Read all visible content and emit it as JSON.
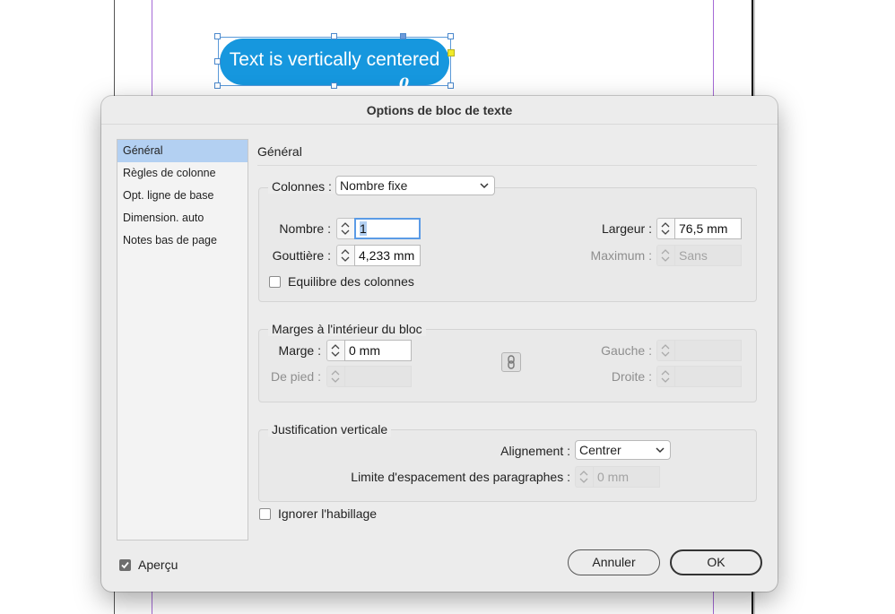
{
  "document": {
    "frame_text": "Text is vertically centered",
    "overflow_glyph": "0"
  },
  "dialog": {
    "title": "Options de bloc de texte",
    "sidebar": {
      "items": [
        {
          "label": "Général",
          "selected": true
        },
        {
          "label": "Règles de colonne",
          "selected": false
        },
        {
          "label": "Opt. ligne de base",
          "selected": false
        },
        {
          "label": "Dimension. auto",
          "selected": false
        },
        {
          "label": "Notes bas de page",
          "selected": false
        }
      ]
    },
    "section_title": "Général",
    "columns": {
      "legend": "Colonnes :",
      "type_value": "Nombre fixe",
      "number_label": "Nombre :",
      "number_value": "1",
      "gutter_label": "Gouttière :",
      "gutter_value": "4,233 mm",
      "width_label": "Largeur :",
      "width_value": "76,5 mm",
      "maximum_label": "Maximum :",
      "maximum_value": "Sans",
      "balance_label": "Equilibre des colonnes",
      "balance_checked": false
    },
    "insets": {
      "legend": "Marges à l'intérieur du bloc",
      "margin_label": "Marge :",
      "margin_value": "0 mm",
      "bottom_label": "De pied :",
      "bottom_value": "",
      "left_label": "Gauche :",
      "left_value": "",
      "right_label": "Droite :",
      "right_value": ""
    },
    "vertical_justification": {
      "legend": "Justification verticale",
      "alignment_label": "Alignement :",
      "alignment_value": "Centrer",
      "spacing_label": "Limite d'espacement des paragraphes :",
      "spacing_value": "0 mm"
    },
    "ignore_wrap": {
      "label": "Ignorer l'habillage",
      "checked": false
    },
    "preview": {
      "label": "Aperçu",
      "checked": true
    },
    "buttons": {
      "cancel": "Annuler",
      "ok": "OK"
    }
  },
  "colors": {
    "frame_fill": "#1697de",
    "selection": "#b3d0f2",
    "focus_ring": "#5b9be6",
    "guide": "#a56ad6"
  }
}
